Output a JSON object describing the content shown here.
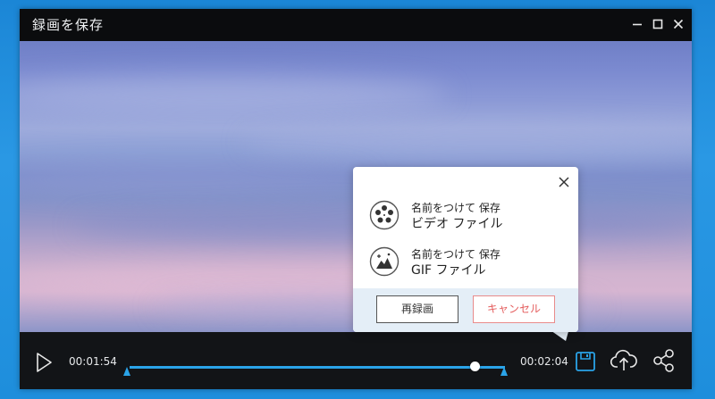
{
  "window": {
    "title": "録画を保存"
  },
  "player": {
    "current_time": "00:01:54",
    "end_time": "00:02:04",
    "progress": 0.92,
    "accent_color": "#2aa3e8"
  },
  "save_popup": {
    "options": [
      {
        "line1": "名前をつけて 保存",
        "line2": "ビデオ ファイル",
        "icon": "film-reel-icon"
      },
      {
        "line1": "名前をつけて 保存",
        "line2": "GIF ファイル",
        "icon": "gif-image-icon"
      }
    ],
    "rerecord_label": "再録画",
    "cancel_label": "キャンセル",
    "cancel_color": "#e45d5d"
  },
  "icons": {
    "play": "play-icon",
    "save": "save-icon",
    "upload": "cloud-upload-icon",
    "share": "share-icon",
    "minimize": "minimize-icon",
    "maximize": "maximize-icon",
    "close": "close-icon"
  }
}
